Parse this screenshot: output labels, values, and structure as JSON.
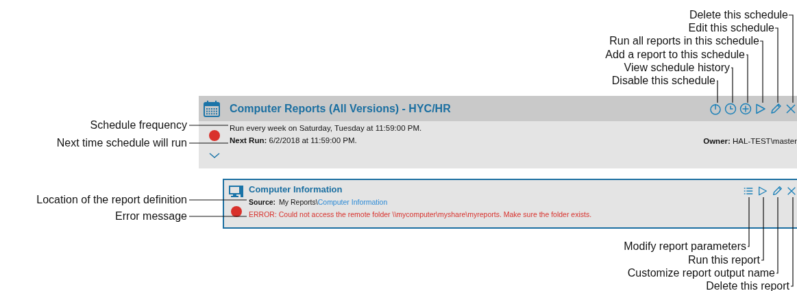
{
  "schedule": {
    "title": "Computer Reports (All Versions) - HYC/HR",
    "frequency": "Run every week on Saturday, Tuesday at 11:59:00 PM.",
    "next_run_label": "Next Run:",
    "next_run": "6/2/2018 at 11:59:00 PM.",
    "owner_label": "Owner:",
    "owner": "HAL-TEST\\master"
  },
  "report": {
    "title": "Computer Information",
    "source_label": "Source:",
    "source_path": "My Reports\\",
    "source_link": "Computer Information",
    "error_label": "ERROR:",
    "error": "Could not access the remote folder \\\\mycomputer\\myshare\\myreports. Make sure the folder exists."
  },
  "callouts": [
    {
      "text": "Delete this schedule"
    },
    {
      "text": "Edit this schedule"
    },
    {
      "text": "Run all reports in this schedule"
    },
    {
      "text": "Add a report to this schedule"
    },
    {
      "text": "View schedule history"
    },
    {
      "text": "Disable this schedule"
    },
    {
      "text": "Schedule frequency"
    },
    {
      "text": "Next time schedule will run"
    },
    {
      "text": "Location of the report definition"
    },
    {
      "text": "Error message"
    },
    {
      "text": "Modify report parameters"
    },
    {
      "text": "Run this report"
    },
    {
      "text": "Customize report output name"
    },
    {
      "text": "Delete this report"
    }
  ]
}
